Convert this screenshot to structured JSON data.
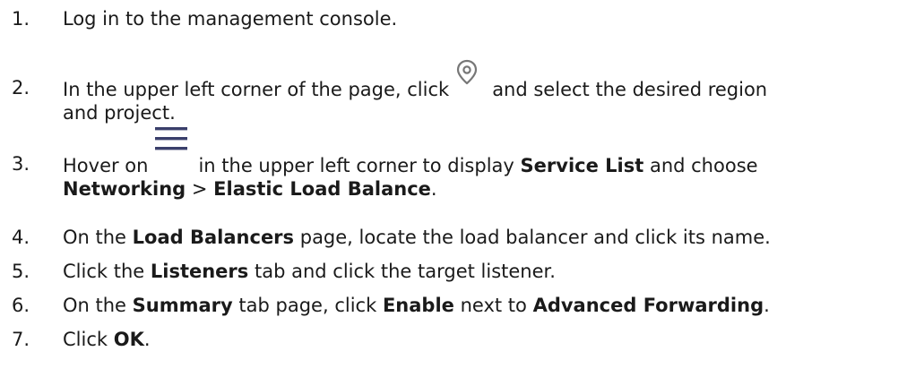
{
  "steps": [
    {
      "num": "1.",
      "text": "Log in to the management console."
    },
    {
      "num": "2.",
      "pre": "In the upper left corner of the page, click",
      "icon": "location-pin-icon",
      "post": "and select the desired region",
      "post2": "and project."
    },
    {
      "num": "3.",
      "pre": "Hover on",
      "icon": "hamburger-menu-icon",
      "mid": "in the upper left corner to display",
      "bold1": "Service List",
      "mid2": "and choose",
      "bold2": "Networking",
      "sep": ">",
      "bold3": "Elastic Load Balance",
      "end": "."
    },
    {
      "num": "4.",
      "pre": "On the",
      "bold1": "Load Balancers",
      "post": "page, locate the load balancer and click its name."
    },
    {
      "num": "5.",
      "pre": "Click the",
      "bold1": "Listeners",
      "post": "tab and click the target listener."
    },
    {
      "num": "6.",
      "pre": "On the",
      "bold1": "Summary",
      "mid": "tab page, click",
      "bold2": "Enable",
      "mid2": "next to",
      "bold3": "Advanced Forwarding",
      "end": "."
    },
    {
      "num": "7.",
      "pre": "Click",
      "bold1": "OK",
      "end": "."
    }
  ],
  "colors": {
    "text": "#1a1a1a",
    "icon": "#777777"
  }
}
